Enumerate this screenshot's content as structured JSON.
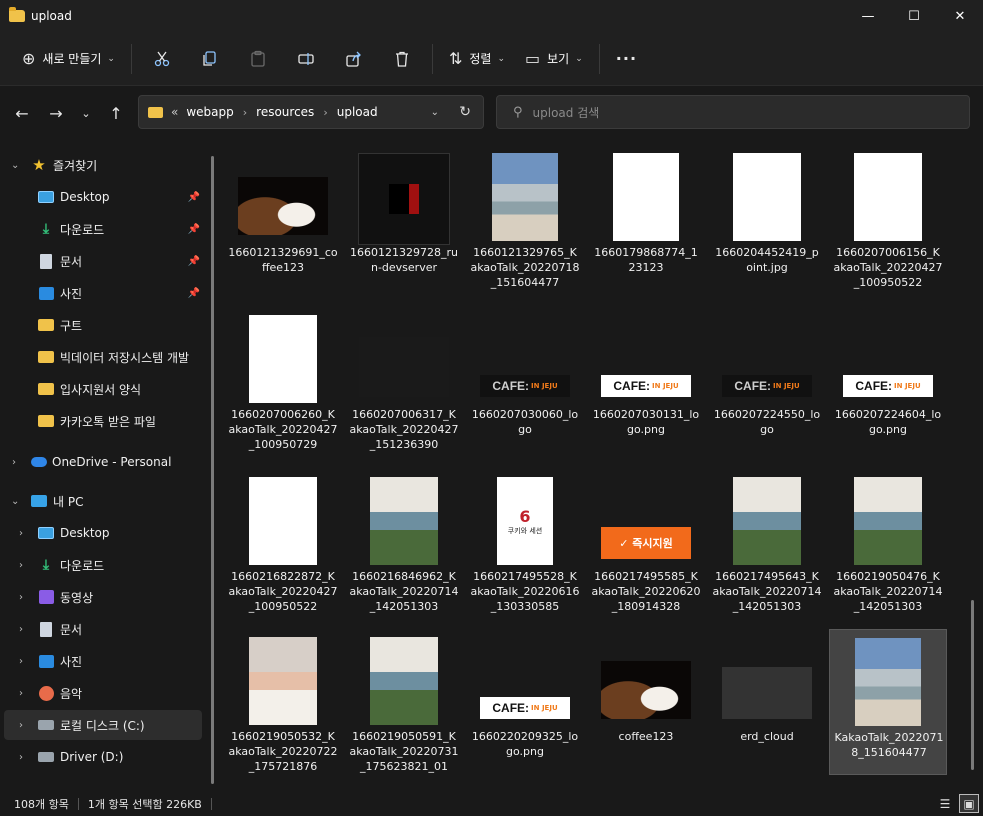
{
  "window": {
    "title": "upload",
    "minimize": "—",
    "maximize": "☐",
    "close": "✕"
  },
  "toolbar": {
    "new_label": "새로 만들기",
    "sort_label": "정렬",
    "view_label": "보기",
    "more": "···"
  },
  "address": {
    "overflow": "«",
    "crumbs": [
      "webapp",
      "resources",
      "upload"
    ],
    "separator": "›"
  },
  "search": {
    "placeholder": "upload 검색"
  },
  "sidebar": {
    "quick_access": "즐겨찾기",
    "quick_items": [
      "Desktop",
      "다운로드",
      "문서",
      "사진",
      "구트",
      "빅데이터 저장시스템 개발",
      "입사지원서 양식",
      "카카오톡 받은 파일"
    ],
    "onedrive": "OneDrive - Personal",
    "this_pc": "내 PC",
    "pc_items": [
      "Desktop",
      "다운로드",
      "동영상",
      "문서",
      "사진",
      "음악",
      "로컬 디스크 (C:)",
      "Driver (D:)"
    ]
  },
  "files": [
    {
      "name": "1660121329691_coffee123",
      "thumb": "coffee"
    },
    {
      "name": "1660121329728_run-devserver",
      "thumb": "dark"
    },
    {
      "name": "1660121329765_KakaoTalk_20220718_151604477",
      "thumb": "beach"
    },
    {
      "name": "1660179868774_123123",
      "thumb": "icedcoffee"
    },
    {
      "name": "1660204452419_point.jpg",
      "thumb": "white"
    },
    {
      "name": "1660207006156_KakaoTalk_20220427_100950522",
      "thumb": "white"
    },
    {
      "name": "1660207006260_KakaoTalk_20220427_100950729",
      "thumb": "white"
    },
    {
      "name": "1660207006317_KakaoTalk_20220427_151236390",
      "thumb": "truck"
    },
    {
      "name": "1660207030060_logo",
      "thumb": "logo-dark"
    },
    {
      "name": "1660207030131_logo.png",
      "thumb": "logo-light"
    },
    {
      "name": "1660207224550_logo",
      "thumb": "logo-dark"
    },
    {
      "name": "1660207224604_logo.png",
      "thumb": "logo-light"
    },
    {
      "name": "1660216822872_KakaoTalk_20220427_100950522",
      "thumb": "white"
    },
    {
      "name": "1660216846962_KakaoTalk_20220714_142051303",
      "thumb": "ppl"
    },
    {
      "name": "1660217495528_KakaoTalk_20220616_130330585",
      "thumb": "book"
    },
    {
      "name": "1660217495585_KakaoTalk_20220620_180914328",
      "thumb": "orange"
    },
    {
      "name": "1660217495643_KakaoTalk_20220714_142051303",
      "thumb": "ppl"
    },
    {
      "name": "1660219050476_KakaoTalk_20220714_142051303",
      "thumb": "ppl"
    },
    {
      "name": "1660219050532_KakaoTalk_20220722_175721876",
      "thumb": "woman"
    },
    {
      "name": "1660219050591_KakaoTalk_20220731_175623821_01",
      "thumb": "ppl"
    },
    {
      "name": "1660220209325_logo.png",
      "thumb": "logo-light"
    },
    {
      "name": "coffee123",
      "thumb": "coffee"
    },
    {
      "name": "erd_cloud",
      "thumb": "erd"
    },
    {
      "name": "KakaoTalk_20220718_151604477",
      "thumb": "beach"
    }
  ],
  "thumb_text": {
    "logo": "CAFE:",
    "logo_sub": "IN JEJU",
    "orange_badge": "✓ 즉시지원",
    "book_num": "6",
    "book_title": "쿠키와 세션"
  },
  "status": {
    "count": "108개 항목",
    "selection": "1개 항목 선택함 226KB"
  }
}
